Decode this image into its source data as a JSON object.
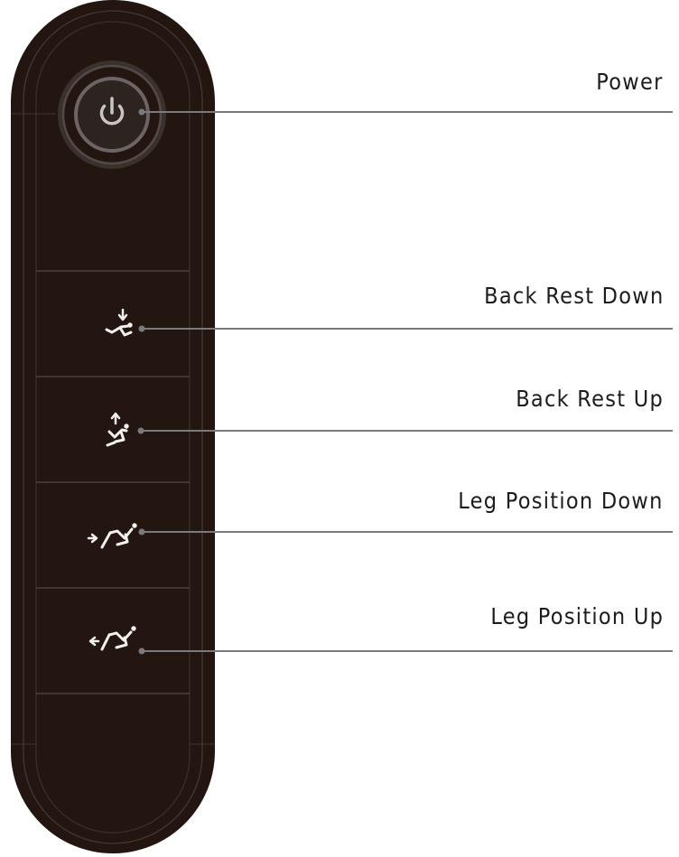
{
  "remote": {
    "body_color": "#231610",
    "outline_color": "#3e3430",
    "leader_color": "#7a7a7a",
    "buttons": [
      {
        "id": "power",
        "label": "Power",
        "icon": "power-icon"
      },
      {
        "id": "back-rest-down",
        "label": "Back Rest Down",
        "icon": "recline-back-down-icon"
      },
      {
        "id": "back-rest-up",
        "label": "Back Rest Up",
        "icon": "recline-back-up-icon"
      },
      {
        "id": "leg-position-down",
        "label": "Leg Position Down",
        "icon": "leg-rest-down-icon"
      },
      {
        "id": "leg-position-up",
        "label": "Leg Position Up",
        "icon": "leg-rest-up-icon"
      }
    ]
  }
}
